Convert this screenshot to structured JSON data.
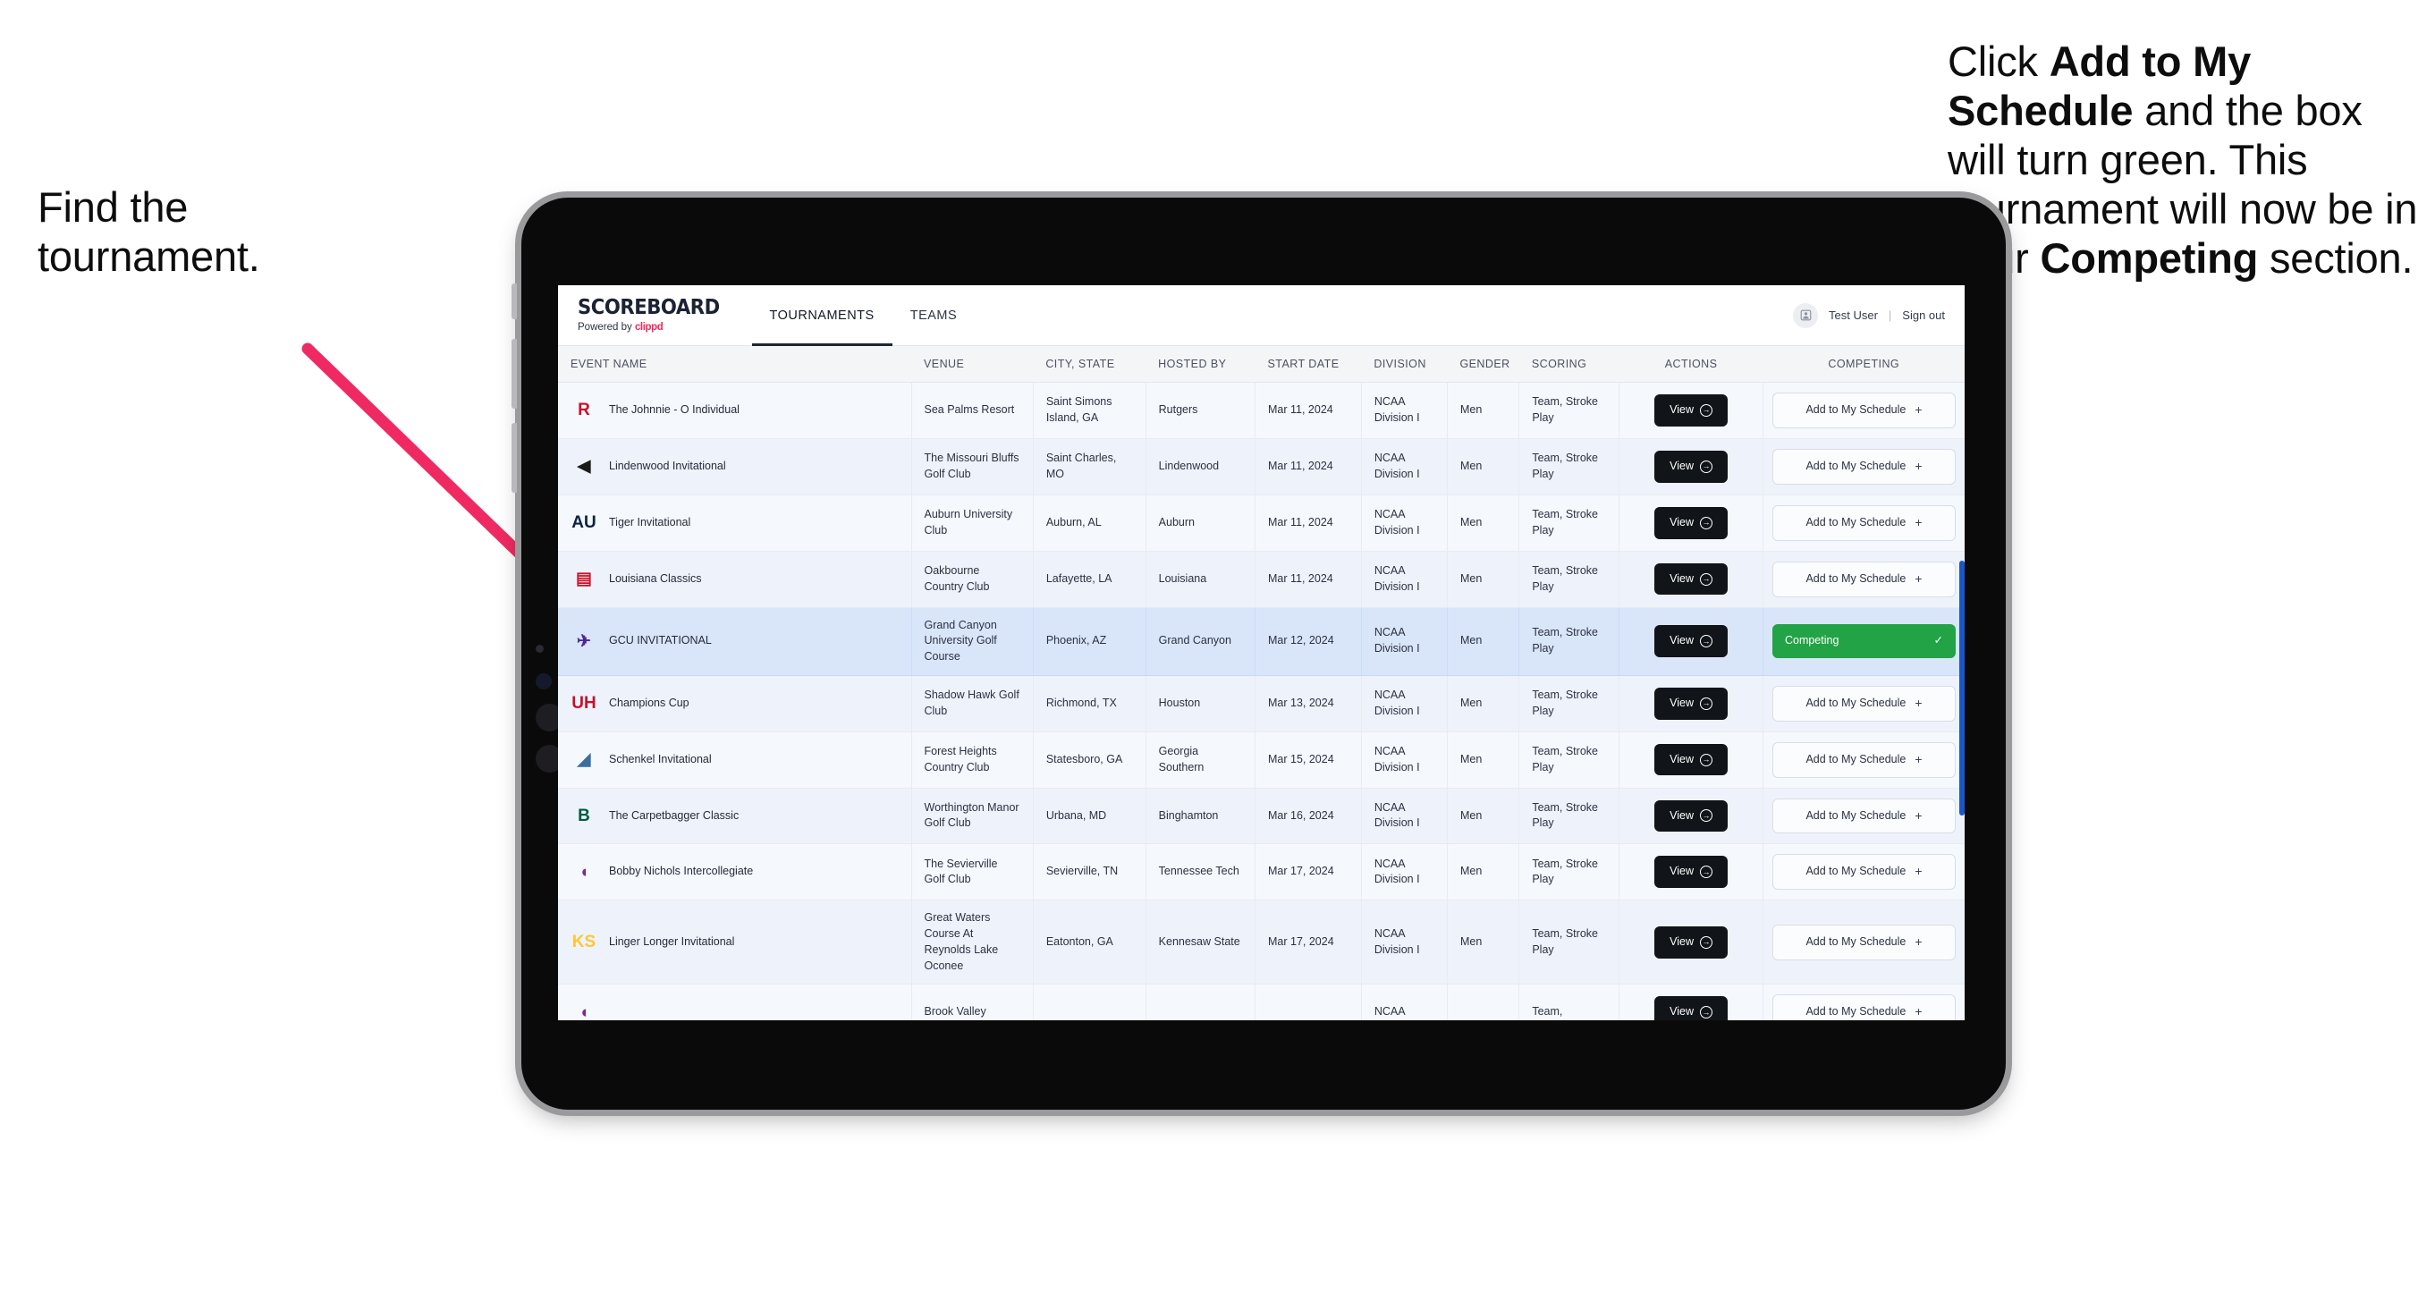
{
  "annotations": {
    "left": "Find the\ntournament.",
    "right_parts": [
      {
        "text": "Click ",
        "bold": false
      },
      {
        "text": "Add to My Schedule",
        "bold": true
      },
      {
        "text": " and the box will turn green. This tournament will now be in your ",
        "bold": false
      },
      {
        "text": "Competing",
        "bold": true
      },
      {
        "text": " section.",
        "bold": false
      }
    ],
    "arrow_color": "#ef2a63"
  },
  "app": {
    "brand": {
      "title": "SCOREBOARD",
      "powered_prefix": "Powered by ",
      "powered_brand": "clippd"
    },
    "nav_tabs": [
      {
        "label": "TOURNAMENTS",
        "active": true
      },
      {
        "label": "TEAMS",
        "active": false
      }
    ],
    "user": {
      "avatar_icon": "user-avatar-icon",
      "name": "Test User",
      "separator": "|",
      "sign_out": "Sign out"
    },
    "accent_green": "#22a345",
    "highlight_row_color": "#d9e6fa"
  },
  "table": {
    "columns": [
      "EVENT NAME",
      "VENUE",
      "CITY, STATE",
      "HOSTED BY",
      "START DATE",
      "DIVISION",
      "GENDER",
      "SCORING",
      "ACTIONS",
      "COMPETING"
    ],
    "view_label": "View",
    "add_label": "Add to My Schedule",
    "add_plus": "+",
    "competing_label": "Competing",
    "competing_check": "✓",
    "rows": [
      {
        "event": "The Johnnie - O Individual",
        "venue": "Sea Palms Resort",
        "city": "Saint Simons Island, GA",
        "hosted_by": "Rutgers",
        "start_date": "Mar 11, 2024",
        "division": "NCAA Division I",
        "gender": "Men",
        "scoring": "Team, Stroke Play",
        "competing": false,
        "logo_text": "R",
        "logo_color": "#c8102e"
      },
      {
        "event": "Lindenwood Invitational",
        "venue": "The Missouri Bluffs Golf Club",
        "city": "Saint Charles, MO",
        "hosted_by": "Lindenwood",
        "start_date": "Mar 11, 2024",
        "division": "NCAA Division I",
        "gender": "Men",
        "scoring": "Team, Stroke Play",
        "competing": false,
        "logo_text": "◀",
        "logo_color": "#1a1a1a"
      },
      {
        "event": "Tiger Invitational",
        "venue": "Auburn University Club",
        "city": "Auburn, AL",
        "hosted_by": "Auburn",
        "start_date": "Mar 11, 2024",
        "division": "NCAA Division I",
        "gender": "Men",
        "scoring": "Team, Stroke Play",
        "competing": false,
        "logo_text": "AU",
        "logo_color": "#0c2340"
      },
      {
        "event": "Louisiana Classics",
        "venue": "Oakbourne Country Club",
        "city": "Lafayette, LA",
        "hosted_by": "Louisiana",
        "start_date": "Mar 11, 2024",
        "division": "NCAA Division I",
        "gender": "Men",
        "scoring": "Team, Stroke Play",
        "competing": false,
        "logo_text": "▤",
        "logo_color": "#ce1126"
      },
      {
        "event": "GCU INVITATIONAL",
        "venue": "Grand Canyon University Golf Course",
        "city": "Phoenix, AZ",
        "hosted_by": "Grand Canyon",
        "start_date": "Mar 12, 2024",
        "division": "NCAA Division I",
        "gender": "Men",
        "scoring": "Team, Stroke Play",
        "competing": true,
        "logo_text": "✈",
        "logo_color": "#522398"
      },
      {
        "event": "Champions Cup",
        "venue": "Shadow Hawk Golf Club",
        "city": "Richmond, TX",
        "hosted_by": "Houston",
        "start_date": "Mar 13, 2024",
        "division": "NCAA Division I",
        "gender": "Men",
        "scoring": "Team, Stroke Play",
        "competing": false,
        "logo_text": "UH",
        "logo_color": "#c8102e"
      },
      {
        "event": "Schenkel Invitational",
        "venue": "Forest Heights Country Club",
        "city": "Statesboro, GA",
        "hosted_by": "Georgia Southern",
        "start_date": "Mar 15, 2024",
        "division": "NCAA Division I",
        "gender": "Men",
        "scoring": "Team, Stroke Play",
        "competing": false,
        "logo_text": "◢",
        "logo_color": "#3c6e9e"
      },
      {
        "event": "The Carpetbagger Classic",
        "venue": "Worthington Manor Golf Club",
        "city": "Urbana, MD",
        "hosted_by": "Binghamton",
        "start_date": "Mar 16, 2024",
        "division": "NCAA Division I",
        "gender": "Men",
        "scoring": "Team, Stroke Play",
        "competing": false,
        "logo_text": "B",
        "logo_color": "#005a43"
      },
      {
        "event": "Bobby Nichols Intercollegiate",
        "venue": "The Sevierville Golf Club",
        "city": "Sevierville, TN",
        "hosted_by": "Tennessee Tech",
        "start_date": "Mar 17, 2024",
        "division": "NCAA Division I",
        "gender": "Men",
        "scoring": "Team, Stroke Play",
        "competing": false,
        "logo_text": "◖",
        "logo_color": "#7d2a8e"
      },
      {
        "event": "Linger Longer Invitational",
        "venue": "Great Waters Course At Reynolds Lake Oconee",
        "city": "Eatonton, GA",
        "hosted_by": "Kennesaw State",
        "start_date": "Mar 17, 2024",
        "division": "NCAA Division I",
        "gender": "Men",
        "scoring": "Team, Stroke Play",
        "competing": false,
        "logo_text": "KS",
        "logo_color": "#ffc62f"
      },
      {
        "event": "",
        "venue": "Brook Valley",
        "city": "",
        "hosted_by": "",
        "start_date": "",
        "division": "NCAA",
        "gender": "",
        "scoring": "Team,",
        "competing": false,
        "logo_text": "◖",
        "logo_color": "#7d2a8e",
        "clipped": true
      }
    ]
  }
}
